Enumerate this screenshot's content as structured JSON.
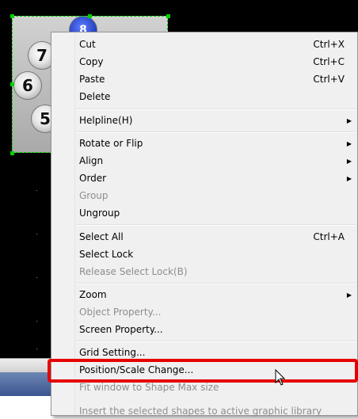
{
  "canvas": {
    "widget": {
      "keys": [
        "7",
        "6",
        "5"
      ],
      "blue_key_label": "8"
    }
  },
  "context_menu": {
    "items": [
      {
        "label": "Cut",
        "shortcut": "Ctrl+X"
      },
      {
        "label": "Copy",
        "shortcut": "Ctrl+C"
      },
      {
        "label": "Paste",
        "shortcut": "Ctrl+V"
      },
      {
        "label": "Delete"
      },
      {
        "label": "Helpline(H)",
        "submenu": true
      },
      {
        "label": "Rotate or Flip",
        "submenu": true
      },
      {
        "label": "Align",
        "submenu": true
      },
      {
        "label": "Order",
        "submenu": true
      },
      {
        "label": "Group",
        "disabled": true
      },
      {
        "label": "Ungroup"
      },
      {
        "label": "Select All",
        "shortcut": "Ctrl+A"
      },
      {
        "label": "Select Lock"
      },
      {
        "label": "Release Select Lock(B)",
        "disabled": true
      },
      {
        "label": "Zoom",
        "submenu": true
      },
      {
        "label": "Object Property...",
        "disabled": true
      },
      {
        "label": "Screen Property..."
      },
      {
        "label": "Grid Setting..."
      },
      {
        "label": "Position/Scale Change...",
        "highlighted": true
      },
      {
        "label": "Fit window to Shape Max size",
        "disabled": true
      },
      {
        "label": "Insert the selected shapes to active graphic library",
        "disabled": true
      }
    ],
    "submenu_arrow": "▶"
  },
  "colors": {
    "highlight_border": "#e60000",
    "selection": "#00d000",
    "canvas_background": "#000000"
  }
}
